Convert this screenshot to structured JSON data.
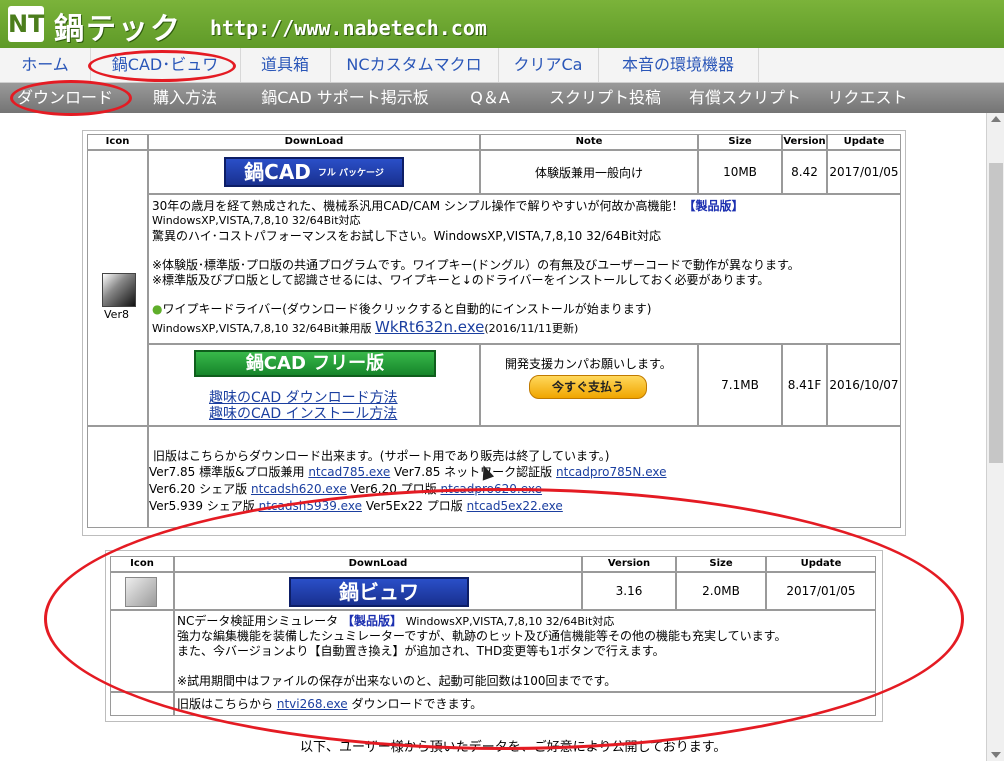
{
  "site": {
    "logo_mark": "NT",
    "logo_text": "鍋テック",
    "url": "http://www.nabetech.com"
  },
  "nav1": [
    "ホーム",
    "鍋CAD･ビュワ",
    "道具箱",
    "NCカスタムマクロ",
    "クリアCa",
    "本音の環境機器"
  ],
  "nav2": [
    "ダウンロード",
    "購入方法",
    "鍋CAD サポート掲示板",
    "Q＆A",
    "スクリプト投稿",
    "有償スクリプト",
    "リクエスト"
  ],
  "table1": {
    "headers": [
      "Icon",
      "DownLoad",
      "Note",
      "Size",
      "Version",
      "Update"
    ],
    "icon_label": "Ver8",
    "full": {
      "banner": "鍋CAD",
      "banner_sub": "フル パッケージ",
      "note": "体験版兼用一般向け",
      "size": "10MB",
      "version": "8.42",
      "update": "2017/01/05"
    },
    "desc": {
      "line1": "30年の歳月を経て熟成された、機械系汎用CAD/CAM シンプル操作で解りやすいが何故か高機能！",
      "line1_badge": "【製品版】",
      "line2": "WindowsXP,VISTA,7,8,10 32/64Bit対応",
      "line3": "驚異のハイ･コストパフォーマンスをお試し下さい。WindowsXP,VISTA,7,8,10 32/64Bit対応",
      "line4": "※体験版･標準版･プロ版の共通プログラムです。ワイプキー(ドングル）の有無及びユーザーコードで動作が異なります。",
      "line5": "※標準版及びプロ版として認識させるには、ワイプキーと↓のドライバーをインストールしておく必要があります。",
      "line6": "ワイプキードライバー(ダウンロード後クリックすると自動的にインストールが始まります)",
      "line7_prefix": "WindowsXP,VISTA,7,8,10 32/64Bit兼用版",
      "line7_link": "WkRt632n.exe",
      "line7_suffix": "(2016/11/11更新)"
    },
    "free": {
      "banner": "鍋CAD フリー版",
      "link1": "趣味のCAD ダウンロード方法",
      "link2": "趣味のCAD インストール方法",
      "note": "開発支援カンパお願いします。",
      "pay_button": "今すぐ支払う",
      "size": "7.1MB",
      "version": "8.41F",
      "update": "2016/10/07"
    },
    "old": {
      "line1": "旧版はこちらからダウンロード出来ます。(サポート用であり販売は終了しています。)",
      "line2_a": "Ver7.85 標準版&プロ版兼用",
      "line2_link1": "ntcad785.exe",
      "line2_b": "Ver7.85 ネットワーク認証版",
      "line2_link2": "ntcadpro785N.exe",
      "line3_a": "Ver6.20 シェア版",
      "line3_link1": "ntcadsh620.exe",
      "line3_b": "Ver6.20 プロ版",
      "line3_link2": "ntcadpro620.exe",
      "line4_a": "Ver5.939 シェア版",
      "line4_link1": "ntcadsh5939.exe",
      "line4_b": "Ver5Ex22 プロ版",
      "line4_link2": "ntcad5ex22.exe"
    }
  },
  "table2": {
    "headers": [
      "Icon",
      "DownLoad",
      "Version",
      "Size",
      "Update"
    ],
    "banner": "鍋ビュワ",
    "version": "3.16",
    "size": "2.0MB",
    "update": "2017/01/05",
    "desc": {
      "line1_a": "NCデータ検証用シミュレータ",
      "line1_badge": "【製品版】",
      "line1_b": "WindowsXP,VISTA,7,8,10 32/64Bit対応",
      "line2": "強力な編集機能を装備したシュミレーターですが、軌跡のヒット及び通信機能等その他の機能も充実しています。",
      "line3": "また、今バージョンより【自動置き換え】が追加され、THD変更等も1ボタンで行えます。",
      "line4": "※試用期間中はファイルの保存が出来ないのと、起動可能回数は100回までです。",
      "old_a": "旧版はこちらから",
      "old_link": "ntvi268.exe",
      "old_b": "ダウンロードできます。"
    }
  },
  "footer": "以下、ユーザー様から頂いたデータを、ご好意により公開しております。",
  "colors": {
    "header_green": "#6ea832",
    "nav_blue": "#2a56b8",
    "highlight_red": "#e41b23"
  }
}
